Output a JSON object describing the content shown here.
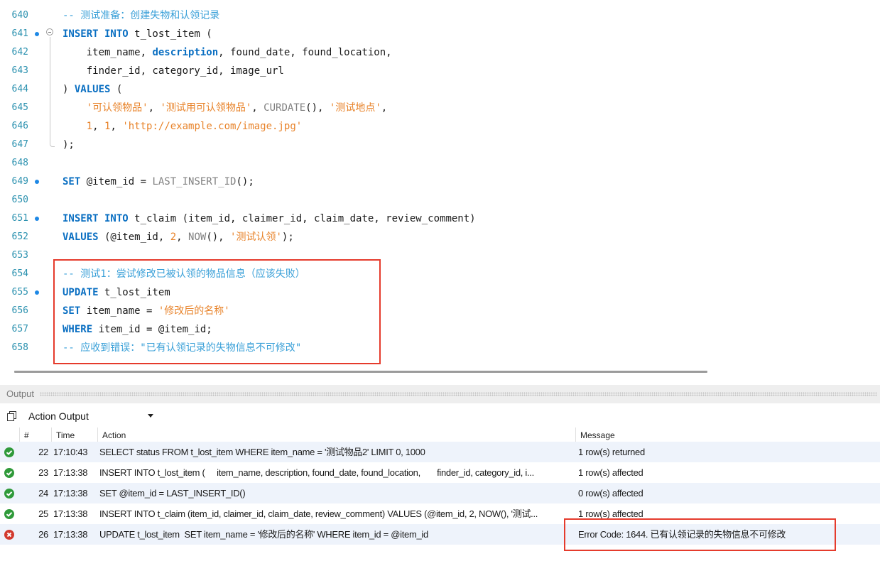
{
  "editor": {
    "lines": [
      {
        "num": "640",
        "bp": false
      },
      {
        "num": "641",
        "bp": true
      },
      {
        "num": "642",
        "bp": false
      },
      {
        "num": "643",
        "bp": false
      },
      {
        "num": "644",
        "bp": false
      },
      {
        "num": "645",
        "bp": false
      },
      {
        "num": "646",
        "bp": false
      },
      {
        "num": "647",
        "bp": false
      },
      {
        "num": "648",
        "bp": false
      },
      {
        "num": "649",
        "bp": true
      },
      {
        "num": "650",
        "bp": false
      },
      {
        "num": "651",
        "bp": true
      },
      {
        "num": "652",
        "bp": false
      },
      {
        "num": "653",
        "bp": false
      },
      {
        "num": "654",
        "bp": false
      },
      {
        "num": "655",
        "bp": true
      },
      {
        "num": "656",
        "bp": false
      },
      {
        "num": "657",
        "bp": false
      },
      {
        "num": "658",
        "bp": false
      }
    ],
    "code": {
      "c640": "-- 测试准备：创建失物和认领记录",
      "c641_kw": "INSERT INTO",
      "c641_rest": " t_lost_item (",
      "c642_a": "    item_name, ",
      "c642_b": "description",
      "c642_c": ", found_date, found_location,",
      "c643": "    finder_id, category_id, image_url",
      "c644_a": ") ",
      "c644_kw": "VALUES",
      "c644_b": " (",
      "c645_s1": "'可认领物品'",
      "c645_s2": "'测试用可认领物品'",
      "c645_fn": "CURDATE",
      "c645_s3": "'测试地点'",
      "c646_n1": "1",
      "c646_n2": "1",
      "c646_s": "'http://example.com/image.jpg'",
      "c647": ");",
      "c649_kw": "SET",
      "c649_var": " @item_id = ",
      "c649_fn": "LAST_INSERT_ID",
      "c649_end": "();",
      "c651_kw": "INSERT INTO",
      "c651_rest": " t_claim (item_id, claimer_id, claim_date, review_comment)",
      "c652_kw": "VALUES",
      "c652_a": " (@item_id, ",
      "c652_n": "2",
      "c652_b": ", ",
      "c652_fn": "NOW",
      "c652_c": "(), ",
      "c652_s": "'测试认领'",
      "c652_d": ");",
      "c654": "-- 测试1：尝试修改已被认领的物品信息（应该失败）",
      "c655_kw": "UPDATE",
      "c655_rest": " t_lost_item",
      "c656_kw": "SET",
      "c656_rest": " item_name = ",
      "c656_s": "'修改后的名称'",
      "c657_kw": "WHERE",
      "c657_rest": " item_id = @item_id;",
      "c658": "-- 应收到错误：\"已有认领记录的失物信息不可修改\""
    }
  },
  "output": {
    "title": "Output",
    "dropdown_value": "Action Output",
    "columns": [
      "",
      "#",
      "Time",
      "Action",
      "Message"
    ],
    "rows": [
      {
        "status": "ok",
        "num": "22",
        "time": "17:10:43",
        "action": "SELECT status FROM t_lost_item WHERE item_name = '测试物品2' LIMIT 0, 1000",
        "message": "1 row(s) returned"
      },
      {
        "status": "ok",
        "num": "23",
        "time": "17:13:38",
        "action": "INSERT INTO t_lost_item (     item_name, description, found_date, found_location,       finder_id, category_id, i...",
        "message": "1 row(s) affected"
      },
      {
        "status": "ok",
        "num": "24",
        "time": "17:13:38",
        "action": "SET @item_id = LAST_INSERT_ID()",
        "message": "0 row(s) affected"
      },
      {
        "status": "ok",
        "num": "25",
        "time": "17:13:38",
        "action": "INSERT INTO t_claim (item_id, claimer_id, claim_date, review_comment) VALUES (@item_id, 2, NOW(), '测试...",
        "message": "1 row(s) affected"
      },
      {
        "status": "err",
        "num": "26",
        "time": "17:13:38",
        "action": "UPDATE t_lost_item  SET item_name = '修改后的名称' WHERE item_id = @item_id",
        "message": "Error Code: 1644. 已有认领记录的失物信息不可修改"
      }
    ]
  },
  "colors": {
    "keyword": "#0a6fc2",
    "string": "#e8832a",
    "comment": "#3aa0d8",
    "highlight": "#e53b2c",
    "ok": "#2f9a3a",
    "error": "#d23a2e"
  }
}
